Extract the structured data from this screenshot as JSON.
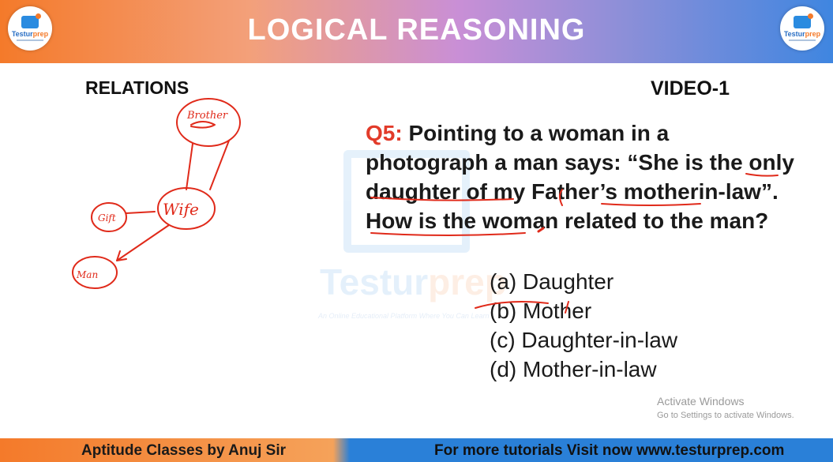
{
  "header": {
    "title": "LOGICAL REASONING",
    "logo_text_a": "Testur",
    "logo_text_b": "prep"
  },
  "section_label": "RELATIONS",
  "video_label": "VIDEO-1",
  "question": {
    "number": "Q5:",
    "text": "Pointing to a woman in a photograph a man says: “She is the only daughter of my Father’s motherin-law”. How is the woman related to the man?"
  },
  "options": [
    "(a) Daughter",
    "(b) Mother",
    "(c) Daughter-in-law",
    "(d) Mother-in-law"
  ],
  "diagram": {
    "top_node": "Brother",
    "middle_node": "Wife",
    "left_node": "Gift",
    "bottom_node": "Man"
  },
  "watermark": {
    "brand_a": "Testur",
    "brand_b": "prep",
    "tagline": "An Online Educational Platform Where You Can Learn"
  },
  "activate_windows": {
    "title": "Activate Windows",
    "subtitle": "Go to Settings to activate Windows."
  },
  "footer": {
    "left": "Aptitude Classes by Anuj Sir",
    "right": "For more tutorials Visit now www.testurprep.com"
  },
  "colors": {
    "accent_red": "#e23b2a",
    "ink_red": "#e02a1a",
    "brand_blue": "#2a80d8",
    "brand_orange": "#f47a2a"
  }
}
